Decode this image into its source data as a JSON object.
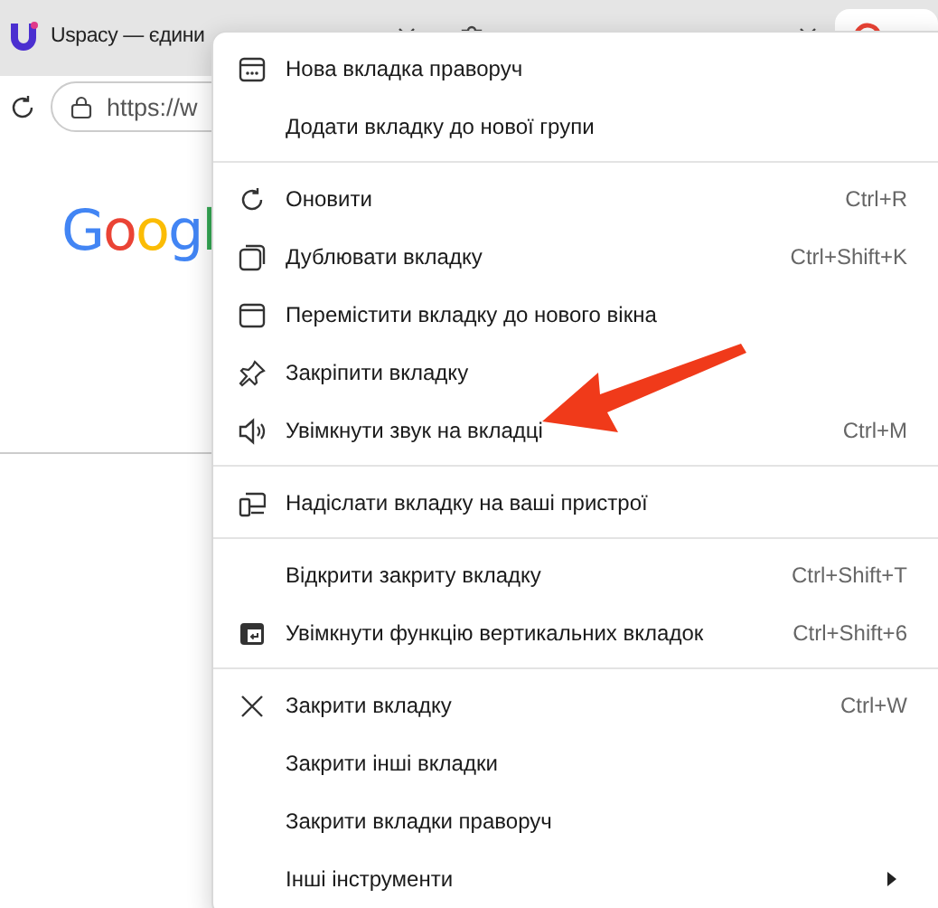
{
  "tabs": [
    {
      "title": "Uspacy — єдини",
      "selected": false
    },
    {
      "selected": false
    },
    {
      "selected": true
    }
  ],
  "address_bar": {
    "url": "https://w"
  },
  "page": {
    "logo": "Googl"
  },
  "context_menu": {
    "items": [
      {
        "kind": "item",
        "label": "Нова вкладка праворуч"
      },
      {
        "kind": "item",
        "label": "Додати вкладку до нової групи"
      },
      {
        "kind": "separator"
      },
      {
        "kind": "item",
        "label": "Оновити",
        "shortcut": "Ctrl+R"
      },
      {
        "kind": "item",
        "label": "Дублювати вкладку",
        "shortcut": "Ctrl+Shift+K"
      },
      {
        "kind": "item",
        "label": "Перемістити вкладку до нового вікна"
      },
      {
        "kind": "item",
        "label": "Закріпити вкладку"
      },
      {
        "kind": "item",
        "label": "Увімкнути звук на вкладці",
        "shortcut": "Ctrl+M"
      },
      {
        "kind": "separator"
      },
      {
        "kind": "item",
        "label": "Надіслати вкладку на ваші пристрої"
      },
      {
        "kind": "separator"
      },
      {
        "kind": "item",
        "label": "Відкрити закриту вкладку",
        "shortcut": "Ctrl+Shift+T"
      },
      {
        "kind": "item",
        "label": "Увімкнути функцію вертикальних вкладок",
        "shortcut": "Ctrl+Shift+6"
      },
      {
        "kind": "separator"
      },
      {
        "kind": "item",
        "label": "Закрити вкладку",
        "shortcut": "Ctrl+W"
      },
      {
        "kind": "item",
        "label": "Закрити інші вкладки"
      },
      {
        "kind": "item",
        "label": "Закрити вкладки праворуч"
      },
      {
        "kind": "item",
        "label": "Інші інструменти",
        "submenu": true
      }
    ]
  },
  "annotation": {
    "kind": "arrow"
  }
}
